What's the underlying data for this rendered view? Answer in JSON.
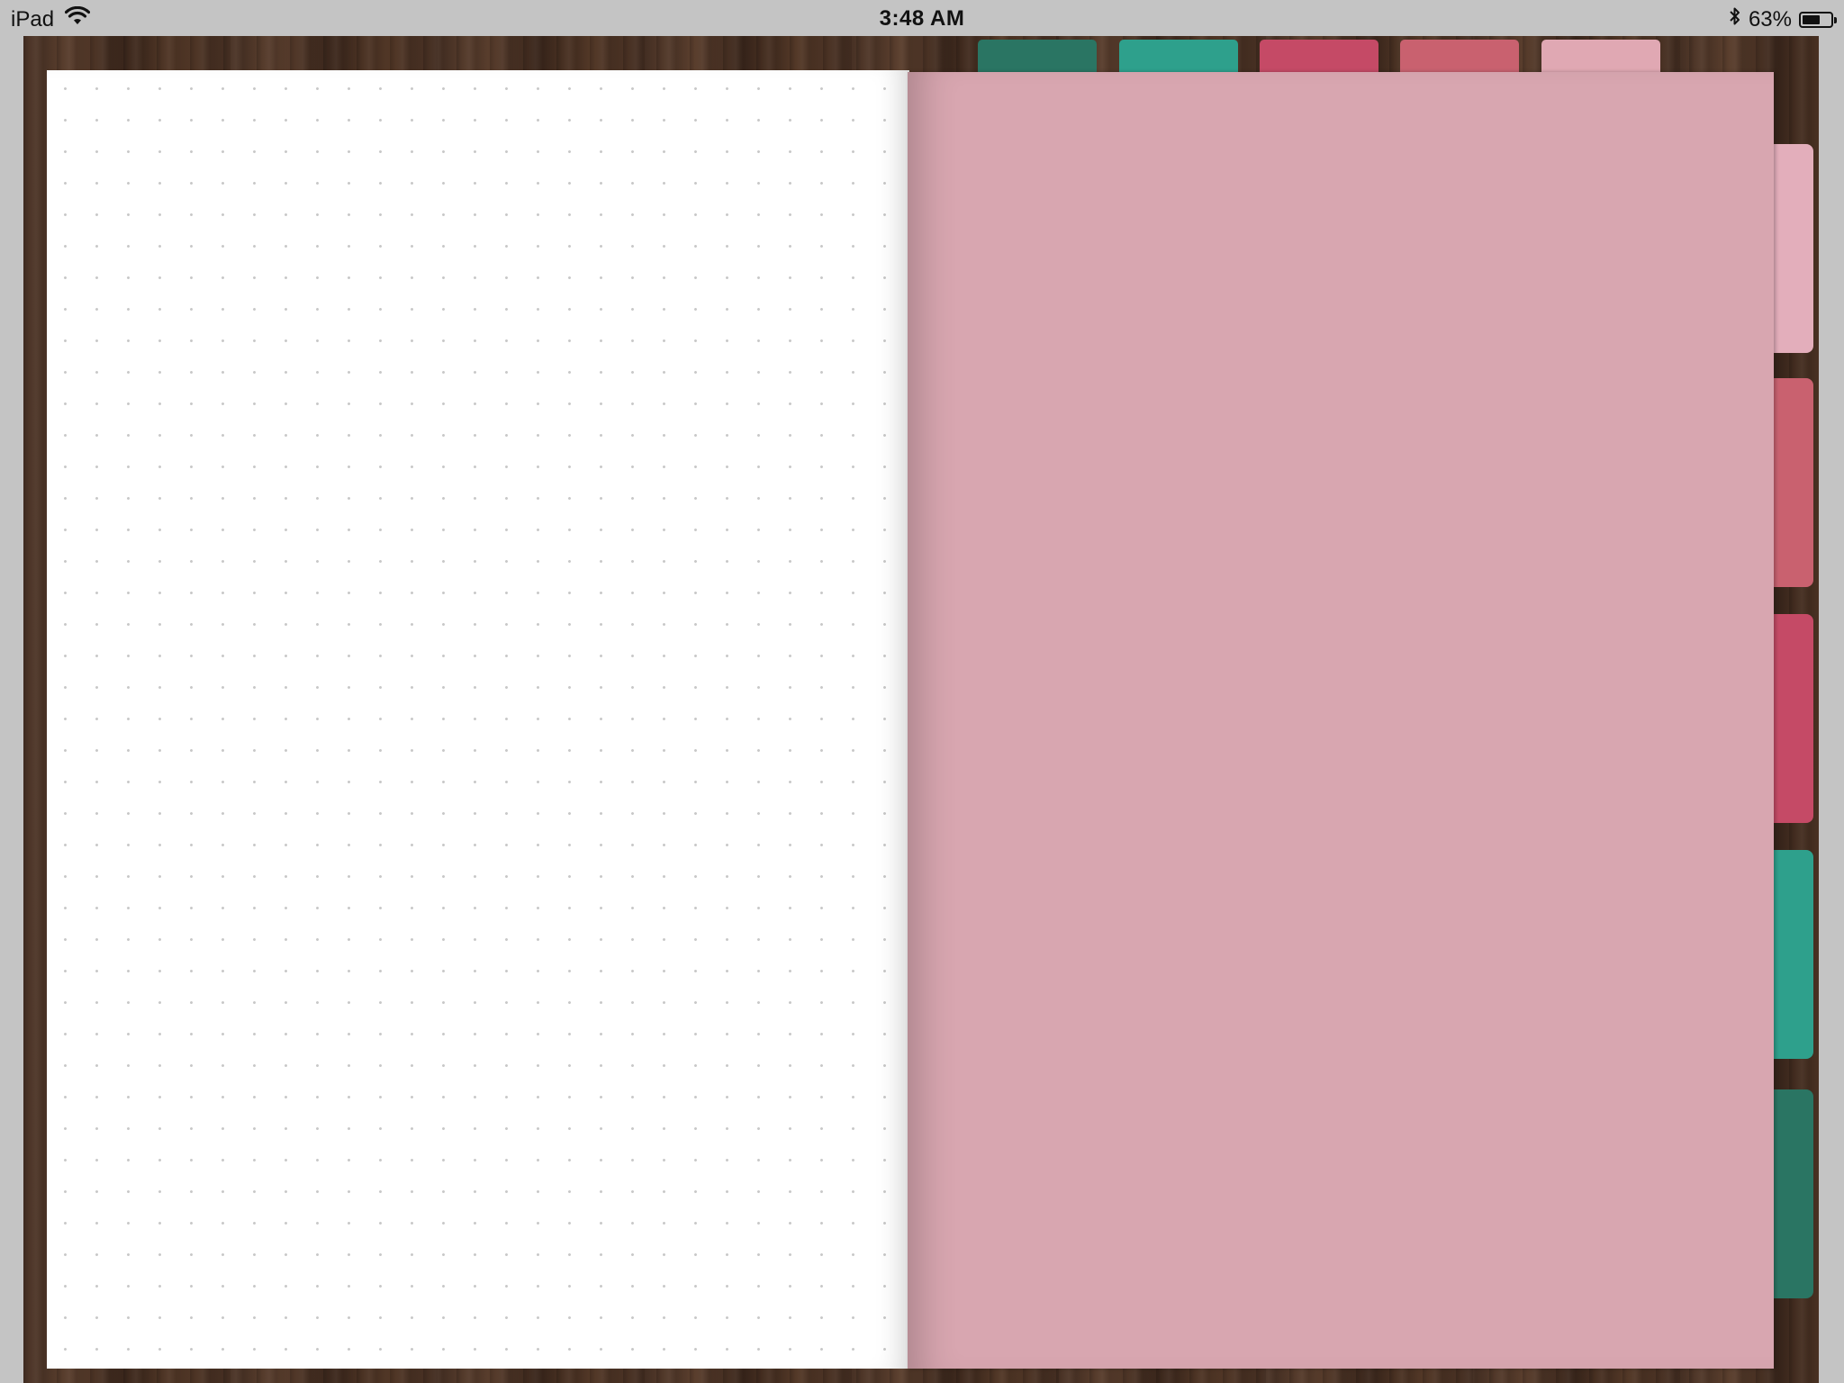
{
  "status_bar": {
    "device": "iPad",
    "time": "3:48 AM",
    "battery_percent": "63%",
    "battery_level": 0.63,
    "icons": [
      "wifi-icon",
      "bluetooth-icon",
      "battery-icon"
    ]
  },
  "notebook": {
    "left_page": {
      "style": "dot-grid",
      "background": "#ffffff",
      "dot_color": "#c9c9c9"
    },
    "right_page": {
      "background": "#d8a6b0"
    }
  },
  "top_tabs": [
    {
      "name": "tab-dark-green",
      "color": "#2a7563"
    },
    {
      "name": "tab-teal",
      "color": "#2ea08c"
    },
    {
      "name": "tab-crimson",
      "color": "#c54a66"
    },
    {
      "name": "tab-rose",
      "color": "#c9616f"
    },
    {
      "name": "tab-light-pink",
      "color": "#e0a8b3"
    }
  ],
  "side_tabs": [
    {
      "name": "side-tab-light-pink",
      "color": "#e3aebb"
    },
    {
      "name": "side-tab-rose",
      "color": "#c9616f"
    },
    {
      "name": "side-tab-crimson",
      "color": "#c54a66"
    },
    {
      "name": "side-tab-teal",
      "color": "#2ea08c"
    },
    {
      "name": "side-tab-dark-green",
      "color": "#2a7563"
    }
  ]
}
